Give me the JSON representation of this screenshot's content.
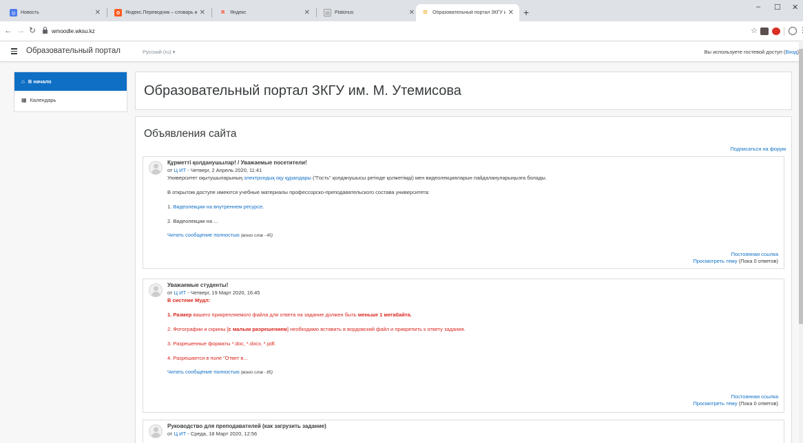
{
  "browser": {
    "tabs": [
      {
        "title": "Новость",
        "fav_bg": "#4b7bec",
        "fav_glyph": "◎"
      },
      {
        "title": "Яндекс.Переводчик – словарь и...",
        "fav_bg": "#ff5a1f",
        "fav_glyph": "✿"
      },
      {
        "title": "Яндекс",
        "fav_bg": "#ffffff",
        "fav_glyph": "Я"
      },
      {
        "title": "Platonus",
        "fav_bg": "#ffffff",
        "fav_glyph": "▤"
      },
      {
        "title": "Образовательный портал ЗКГУ и...",
        "fav_bg": "#ffffff",
        "fav_glyph": "⛫"
      }
    ],
    "url": "wmoodle.wksu.kz"
  },
  "navbar": {
    "brand": "Образовательный портал",
    "language": "Русский (ru)",
    "guest_text": "Вы используете гостевой доступ (",
    "login_link": "Вход",
    "guest_close": ")"
  },
  "drawer": {
    "items": [
      {
        "label": "В начало",
        "icon": "home-icon",
        "active": true
      },
      {
        "label": "Календарь",
        "icon": "calendar-icon",
        "active": false
      }
    ]
  },
  "page": {
    "title": "Образовательный портал ЗКГУ им. М. Утемисова",
    "section_title": "Объявления сайта",
    "subscribe": "Подписаться на форум"
  },
  "posts": [
    {
      "subject": "Құрметті қолданушылар! / Уважаемые посетители!",
      "by": "от",
      "author": "Ц ИТ",
      "date": " - Четверг, 2 Апрель 2020, 11:41",
      "p1_a": "Университет оқытушыларының ",
      "p1_link": "электрондық оқу құралдары",
      "p1_b": " (\"Гость\" қолданушысы ретінде қолжетімді) мен видеолекцияларын пайдалануларыңызға болады.",
      "p2": "В открытом доступе имеются учебные материалы профессорско-преподавательского состава университета:",
      "p3_num": "1. ",
      "p3_link": "Видеолекции на внутреннем ресурсе.",
      "p4": "2. Видеолекции на ...",
      "readmore": "Читать сообщение полностью",
      "words": "(всего слов - 45)",
      "permalink": "Постоянная ссылка",
      "view_topic": "Просмотреть тему",
      "replies": " (Пока 0 ответов)"
    },
    {
      "subject": "Уважаемые студенты!",
      "by": "от",
      "author": "Ц ИТ",
      "date": " - Четверг, 19 Март 2020, 16:45",
      "heading": "В системе Мудл:",
      "l1_a": "1. Размер",
      "l1_b": " вашего прикрепляемого файла для ответа на задание должен быть ",
      "l1_c": "меньше 1 мегабайта.",
      "l2_a": "2. Фотографии и скрины [",
      "l2_b": "с малым разрешением",
      "l2_c": "] необходимо вставить в вордовский файл и прикрепить к ответу задания.",
      "l3": "3. Разрешенные форматы *.doc, *.docx, *.pdf.",
      "l4": "4. Разрешается в поле \"Ответ в...",
      "readmore": "Читать сообщение полностью",
      "words": "(всего слов - 85)",
      "permalink": "Постоянная ссылка",
      "view_topic": "Просмотреть тему",
      "replies": " (Пока 0 ответов)"
    },
    {
      "subject": "Руководство для преподавателей (как загрузить задание)",
      "by": "от",
      "author": "Ц ИТ",
      "date": " - Среда, 18 Март 2020, 12:56"
    }
  ],
  "colors": {
    "accent": "#0f6fc5",
    "danger": "#d9251c"
  }
}
